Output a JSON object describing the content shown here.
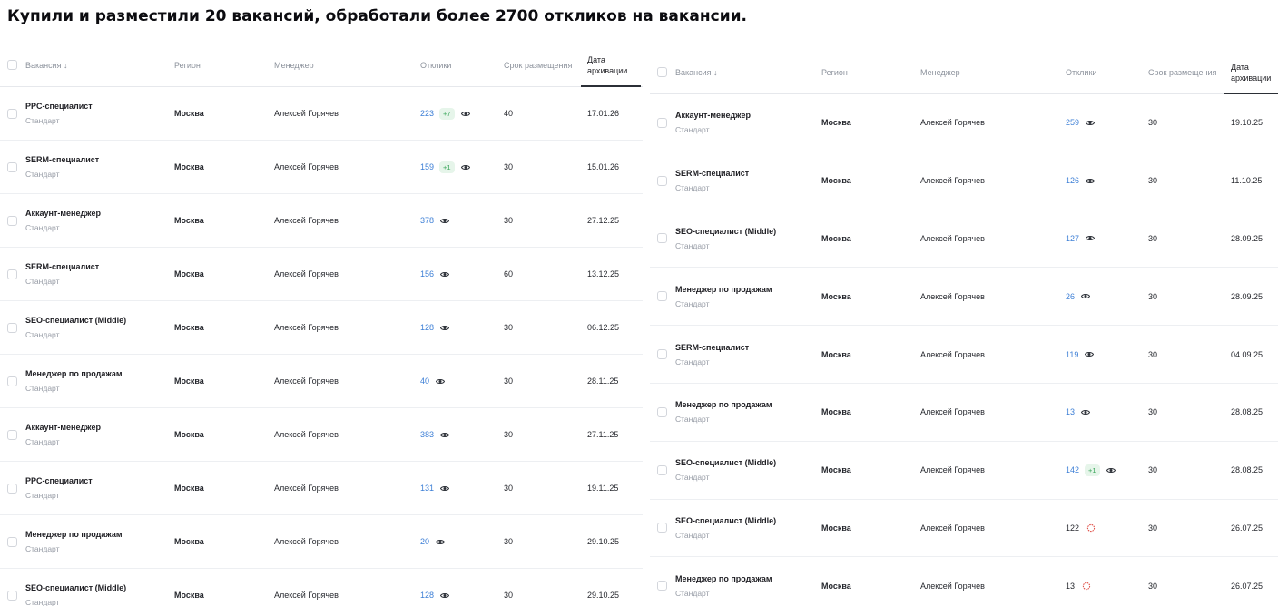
{
  "heading": "Купили и разместили 20 вакансий, обработали более 2700 откликов на вакансии.",
  "columns": {
    "vacancy": "Вакансия ↓",
    "region": "Регион",
    "manager": "Менеджер",
    "responses": "Отклики",
    "period": "Срок размещения",
    "archive_date": "Дата архивации"
  },
  "icons": {
    "eye": "eye-icon",
    "alert": "alert-icon",
    "checkbox": "checkbox-icon"
  },
  "colors": {
    "link": "#3d7fd6",
    "badge_bg": "#e6f5ea",
    "badge_text": "#3aa65a",
    "alert": "#e0524a"
  },
  "left_table": {
    "rows": [
      {
        "title": "PPC-специалист",
        "tier": "Стандарт",
        "region": "Москва",
        "manager": "Алексей Горячев",
        "responses": "223",
        "badge": "+7",
        "period": "40",
        "date": "17.01.26"
      },
      {
        "title": "SERM-специалист",
        "tier": "Стандарт",
        "region": "Москва",
        "manager": "Алексей Горячев",
        "responses": "159",
        "badge": "+1",
        "period": "30",
        "date": "15.01.26"
      },
      {
        "title": "Аккаунт-менеджер",
        "tier": "Стандарт",
        "region": "Москва",
        "manager": "Алексей Горячев",
        "responses": "378",
        "badge": "",
        "period": "30",
        "date": "27.12.25"
      },
      {
        "title": "SERM-специалист",
        "tier": "Стандарт",
        "region": "Москва",
        "manager": "Алексей Горячев",
        "responses": "156",
        "badge": "",
        "period": "60",
        "date": "13.12.25"
      },
      {
        "title": "SEO-специалист (Middle)",
        "tier": "Стандарт",
        "region": "Москва",
        "manager": "Алексей Горячев",
        "responses": "128",
        "badge": "",
        "period": "30",
        "date": "06.12.25"
      },
      {
        "title": "Менеджер по продажам",
        "tier": "Стандарт",
        "region": "Москва",
        "manager": "Алексей Горячев",
        "responses": "40",
        "badge": "",
        "period": "30",
        "date": "28.11.25"
      },
      {
        "title": "Аккаунт-менеджер",
        "tier": "Стандарт",
        "region": "Москва",
        "manager": "Алексей Горячев",
        "responses": "383",
        "badge": "",
        "period": "30",
        "date": "27.11.25"
      },
      {
        "title": "PPC-специалист",
        "tier": "Стандарт",
        "region": "Москва",
        "manager": "Алексей Горячев",
        "responses": "131",
        "badge": "",
        "period": "30",
        "date": "19.11.25"
      },
      {
        "title": "Менеджер по продажам",
        "tier": "Стандарт",
        "region": "Москва",
        "manager": "Алексей Горячев",
        "responses": "20",
        "badge": "",
        "period": "30",
        "date": "29.10.25"
      },
      {
        "title": "SEO-специалист (Middle)",
        "tier": "Стандарт",
        "region": "Москва",
        "manager": "Алексей Горячев",
        "responses": "128",
        "badge": "",
        "period": "30",
        "date": "29.10.25"
      }
    ]
  },
  "right_table": {
    "rows": [
      {
        "title": "Аккаунт-менеджер",
        "tier": "Стандарт",
        "region": "Москва",
        "manager": "Алексей Горячев",
        "responses": "259",
        "badge": "",
        "period": "30",
        "date": "19.10.25",
        "status": "eye"
      },
      {
        "title": "SERM-специалист",
        "tier": "Стандарт",
        "region": "Москва",
        "manager": "Алексей Горячев",
        "responses": "126",
        "badge": "",
        "period": "30",
        "date": "11.10.25",
        "status": "eye"
      },
      {
        "title": "SEO-специалист (Middle)",
        "tier": "Стандарт",
        "region": "Москва",
        "manager": "Алексей Горячев",
        "responses": "127",
        "badge": "",
        "period": "30",
        "date": "28.09.25",
        "status": "eye"
      },
      {
        "title": "Менеджер по продажам",
        "tier": "Стандарт",
        "region": "Москва",
        "manager": "Алексей Горячев",
        "responses": "26",
        "badge": "",
        "period": "30",
        "date": "28.09.25",
        "status": "eye"
      },
      {
        "title": "SERM-специалист",
        "tier": "Стандарт",
        "region": "Москва",
        "manager": "Алексей Горячев",
        "responses": "119",
        "badge": "",
        "period": "30",
        "date": "04.09.25",
        "status": "eye"
      },
      {
        "title": "Менеджер по продажам",
        "tier": "Стандарт",
        "region": "Москва",
        "manager": "Алексей Горячев",
        "responses": "13",
        "badge": "",
        "period": "30",
        "date": "28.08.25",
        "status": "eye"
      },
      {
        "title": "SEO-специалист (Middle)",
        "tier": "Стандарт",
        "region": "Москва",
        "manager": "Алексей Горячев",
        "responses": "142",
        "badge": "+1",
        "period": "30",
        "date": "28.08.25",
        "status": "eye"
      },
      {
        "title": "SEO-специалист (Middle)",
        "tier": "Стандарт",
        "region": "Москва",
        "manager": "Алексей Горячев",
        "responses": "122",
        "badge": "",
        "period": "30",
        "date": "26.07.25",
        "status": "alert"
      },
      {
        "title": "Менеджер по продажам",
        "tier": "Стандарт",
        "region": "Москва",
        "manager": "Алексей Горячев",
        "responses": "13",
        "badge": "",
        "period": "30",
        "date": "26.07.25",
        "status": "alert"
      }
    ]
  }
}
